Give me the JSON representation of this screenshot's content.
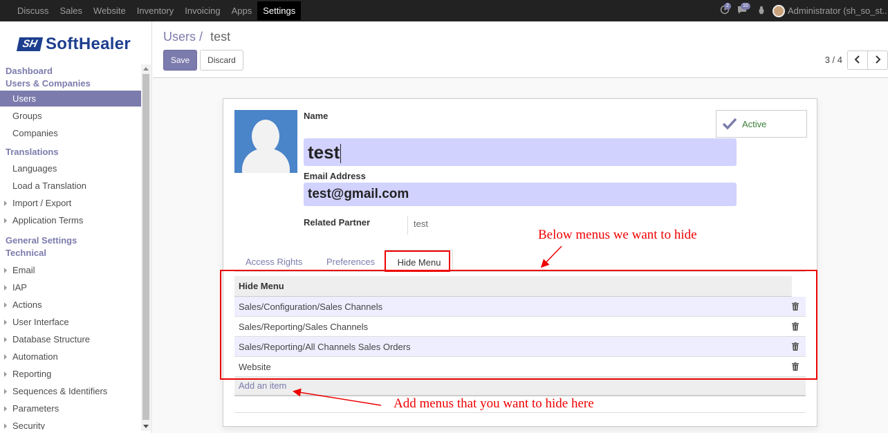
{
  "topbar": {
    "menu": [
      "Discuss",
      "Sales",
      "Website",
      "Inventory",
      "Invoicing",
      "Apps",
      "Settings"
    ],
    "active_menu": "Settings",
    "activity_count": "2",
    "message_count": "10",
    "user": "Administrator (sh_so_st..."
  },
  "sidebar": {
    "logo_mark": "SH",
    "logo_text": "SoftHealer",
    "dashboard": "Dashboard",
    "users_companies": "Users & Companies",
    "users": "Users",
    "groups": "Groups",
    "companies": "Companies",
    "translations": "Translations",
    "languages": "Languages",
    "load_translation": "Load a Translation",
    "import_export": "Import / Export",
    "application_terms": "Application Terms",
    "general_settings": "General Settings",
    "technical": "Technical",
    "email": "Email",
    "iap": "IAP",
    "actions": "Actions",
    "user_interface": "User Interface",
    "database_structure": "Database Structure",
    "automation": "Automation",
    "reporting": "Reporting",
    "sequences": "Sequences & Identifiers",
    "parameters": "Parameters",
    "security": "Security"
  },
  "control_panel": {
    "breadcrumb_parent": "Users",
    "breadcrumb_sep": "/",
    "breadcrumb_current": "test",
    "save": "Save",
    "discard": "Discard",
    "pager": "3 / 4"
  },
  "form": {
    "name_label": "Name",
    "name_value": "test",
    "email_label": "Email Address",
    "email_value": "test@gmail.com",
    "partner_label": "Related Partner",
    "partner_value": "test",
    "active_label": "Active",
    "tabs": {
      "access_rights": "Access Rights",
      "preferences": "Preferences",
      "hide_menu": "Hide Menu"
    },
    "table_header": "Hide Menu",
    "rows": [
      "Sales/Configuration/Sales Channels",
      "Sales/Reporting/Sales Channels",
      "Sales/Reporting/All Channels Sales Orders",
      "Website"
    ],
    "add_item": "Add an item"
  },
  "annotations": {
    "top": "Below menus we want to hide",
    "bottom": "Add menus that you want to hide here"
  },
  "colors": {
    "accent": "#7c7bad",
    "annotation": "#e00000",
    "input_bg": "#d2d2ff"
  }
}
